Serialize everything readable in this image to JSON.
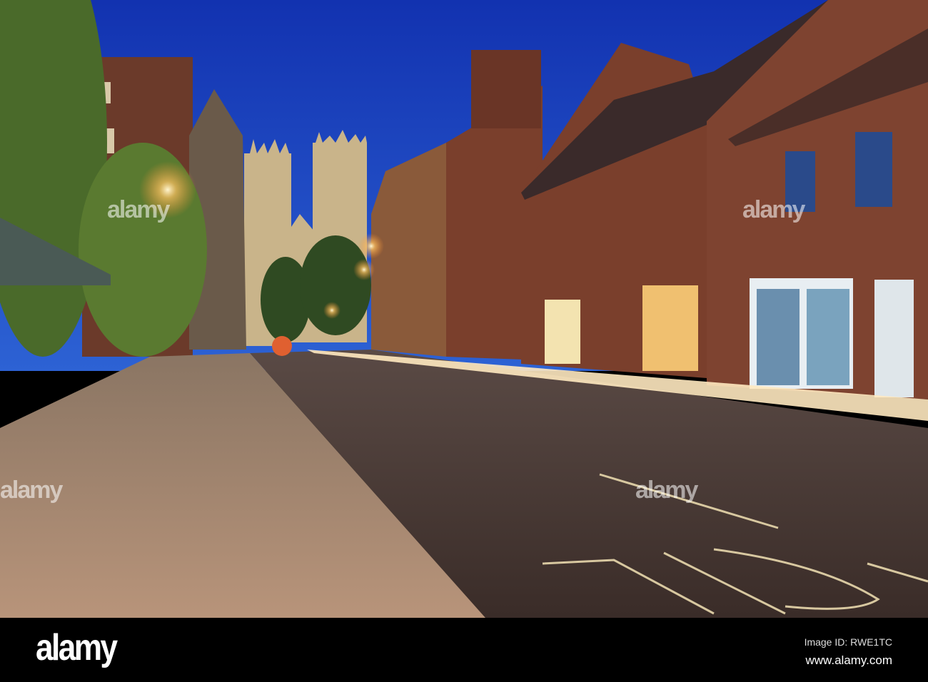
{
  "photo": {
    "subject": "York street at dusk with minster",
    "watermark_text": "alamy"
  },
  "footer": {
    "logo": "alamy",
    "image_id": "Image ID: RWE1TC",
    "url": "www.alamy.com"
  },
  "colors": {
    "sky_top": "#1232b0",
    "sky_bottom": "#2d62d4",
    "brick": "#7a3f2c",
    "stone": "#c9b48a"
  }
}
